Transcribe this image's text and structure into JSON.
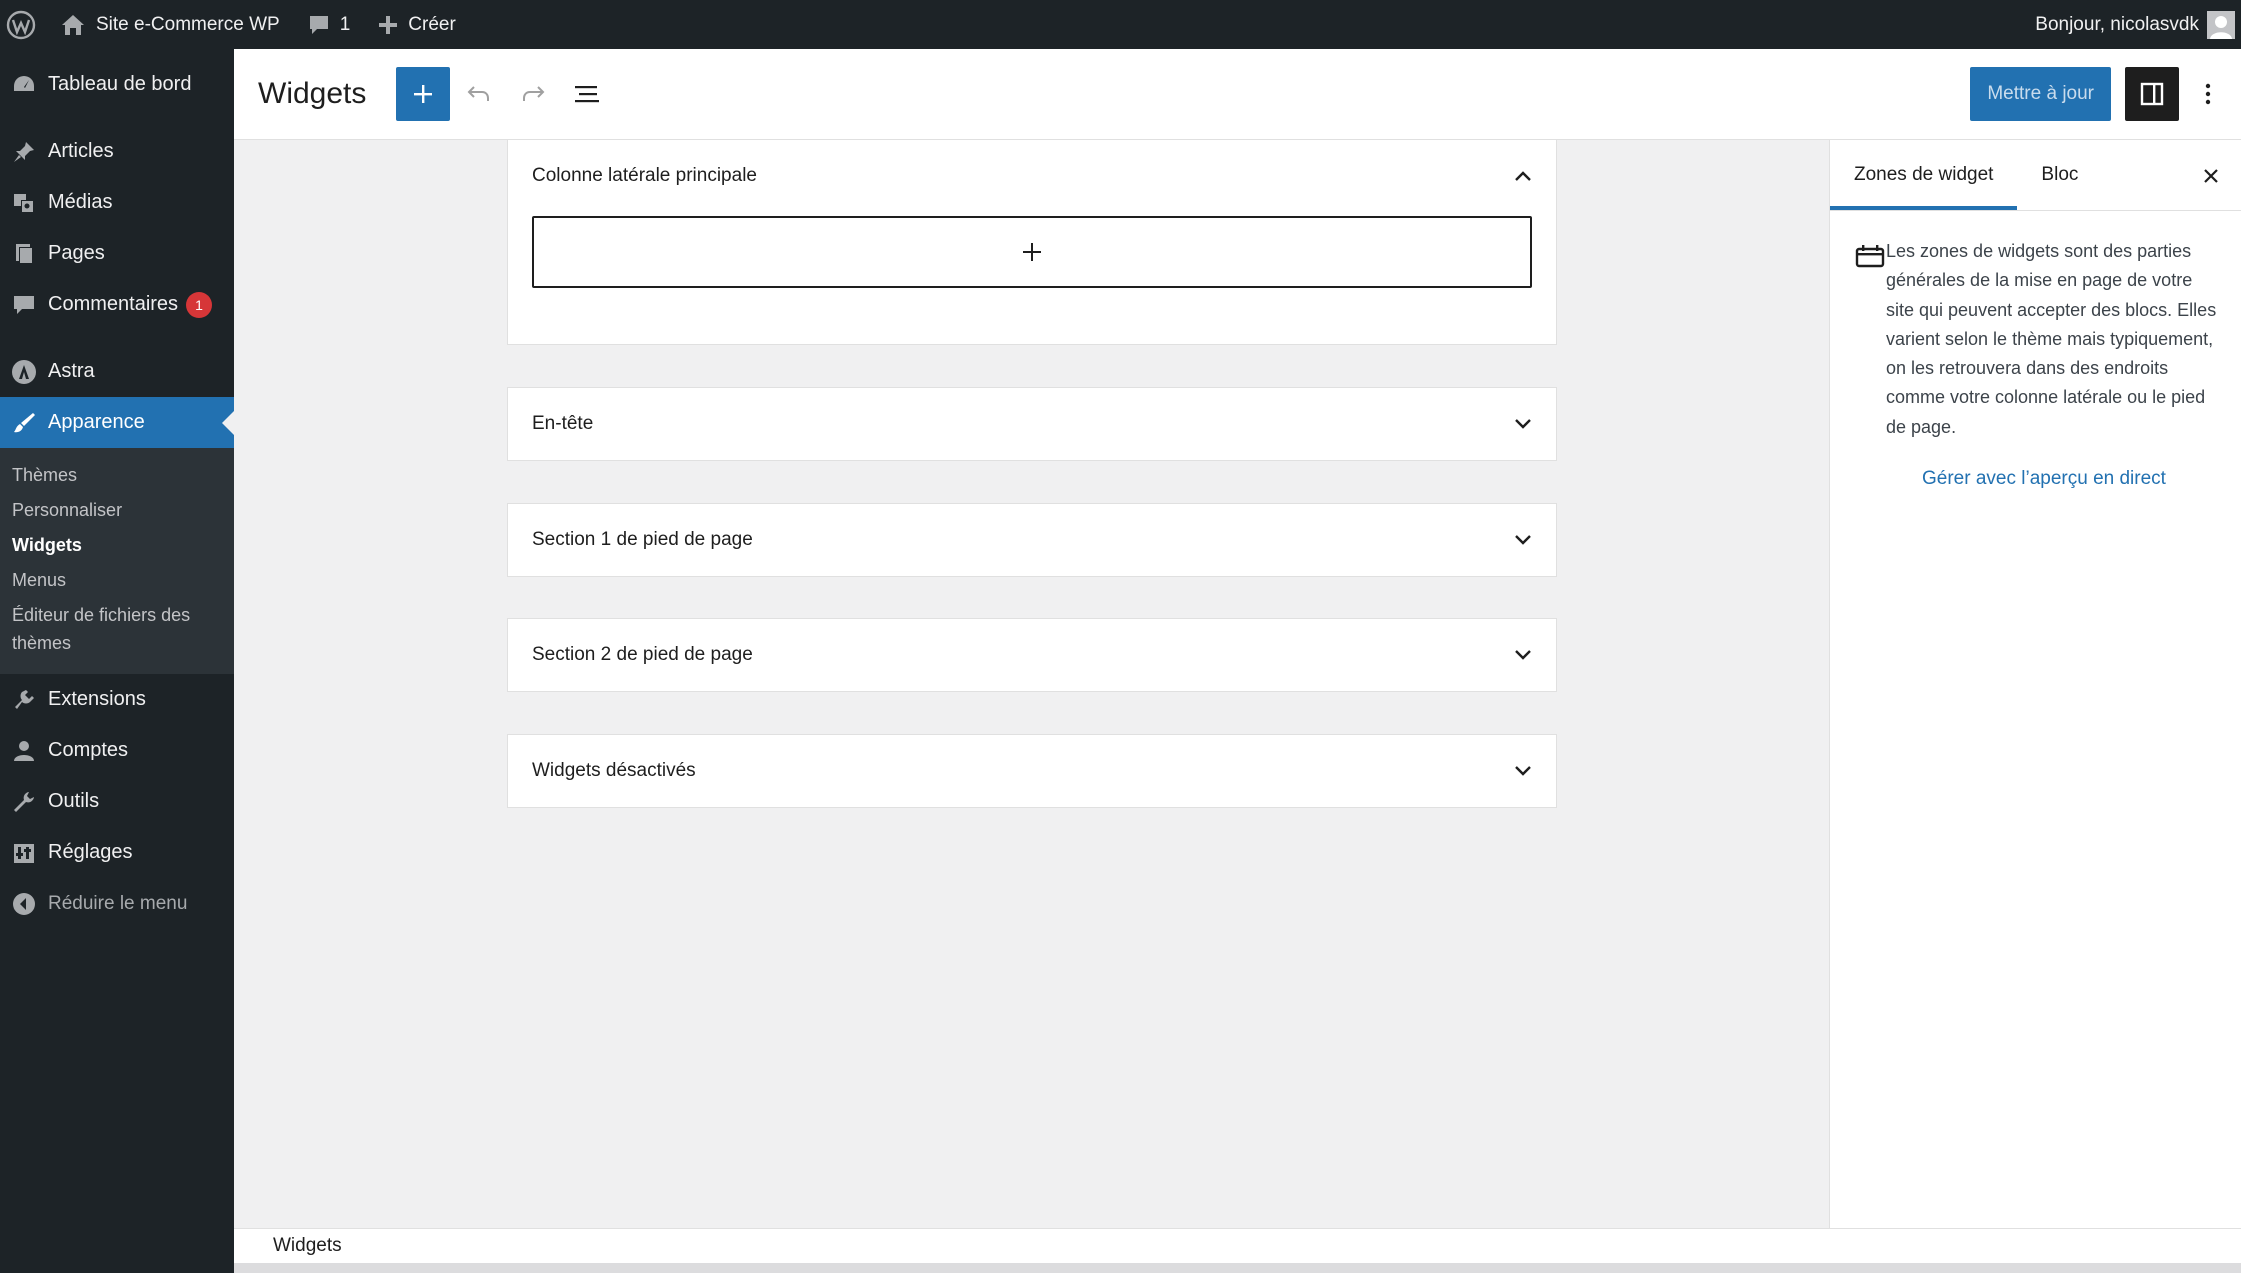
{
  "adminbar": {
    "site_name": "Site e-Commerce WP",
    "comments_count": "1",
    "new_label": "Créer",
    "greeting": "Bonjour, nicolasvdk"
  },
  "sidebar": {
    "items": [
      {
        "label": "Tableau de bord",
        "icon": "dashboard-icon"
      },
      {
        "label": "Articles",
        "icon": "pin-icon"
      },
      {
        "label": "Médias",
        "icon": "media-icon"
      },
      {
        "label": "Pages",
        "icon": "pages-icon"
      },
      {
        "label": "Commentaires",
        "icon": "comment-icon",
        "badge": "1"
      },
      {
        "label": "Astra",
        "icon": "astra-icon"
      },
      {
        "label": "Apparence",
        "icon": "brush-icon",
        "current": true
      },
      {
        "label": "Extensions",
        "icon": "plugin-icon"
      },
      {
        "label": "Comptes",
        "icon": "user-icon"
      },
      {
        "label": "Outils",
        "icon": "wrench-icon"
      },
      {
        "label": "Réglages",
        "icon": "settings-icon"
      }
    ],
    "submenu": [
      "Thèmes",
      "Personnaliser",
      "Widgets",
      "Menus",
      "Éditeur de fichiers des thèmes"
    ],
    "collapse_label": "Réduire le menu"
  },
  "header": {
    "title": "Widgets",
    "update_label": "Mettre à jour"
  },
  "areas": [
    {
      "title": "Colonne latérale principale",
      "expanded": true
    },
    {
      "title": "En-tête",
      "expanded": false
    },
    {
      "title": "Section 1 de pied de page",
      "expanded": false
    },
    {
      "title": "Section 2 de pied de page",
      "expanded": false
    },
    {
      "title": "Widgets désactivés",
      "expanded": false
    }
  ],
  "panel": {
    "tab_zones": "Zones de widget",
    "tab_bloc": "Bloc",
    "description": "Les zones de widgets sont des parties générales de la mise en page de votre site qui peuvent accepter des blocs. Elles varient selon le thème mais typiquement, on les retrouvera dans des endroits comme votre colonne latérale ou le pied de page.",
    "link": "Gérer avec l’aperçu en direct"
  },
  "footer": {
    "breadcrumb": "Widgets"
  },
  "colors": {
    "accent": "#2271b1",
    "adminbar": "#1d2327",
    "badge": "#d63638"
  }
}
